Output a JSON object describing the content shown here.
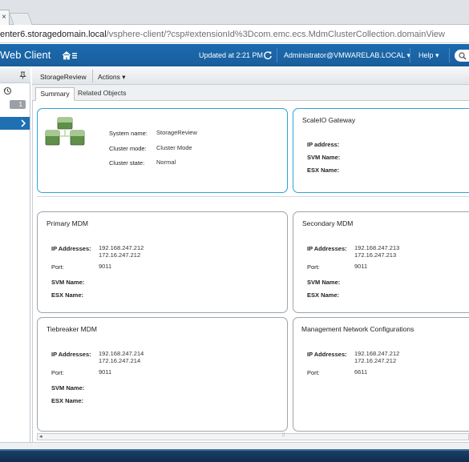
{
  "browser": {
    "tab_close": "×",
    "address_host": "enter6.storagedomain.local",
    "address_path": "/vsphere-client/?csp#extensionId%3Dcom.emc.ecs.MdmClusterCollection.domainView"
  },
  "header": {
    "app_title": "Web Client",
    "updated": "Updated at 2:21 PM",
    "user": "Administrator@VMWARELAB.LOCAL ▾",
    "help": "Help ▾"
  },
  "navigator": {
    "badge": "1"
  },
  "object": {
    "name": "StorageReview",
    "actions": "Actions ▾"
  },
  "tabs": {
    "summary": "Summary",
    "related": "Related Objects"
  },
  "system": {
    "name_label": "System name:",
    "name_value": "StorageReview",
    "mode_label": "Cluster mode:",
    "mode_value": "Cluster Mode",
    "state_label": "Cluster state:",
    "state_value": "Normal"
  },
  "gateway": {
    "title": "ScaleIO Gateway",
    "ip_label": "IP address:",
    "svm_label": "SVM Name:",
    "esx_label": "ESX Name:"
  },
  "primary": {
    "title": "Primary MDM",
    "ip_label": "IP Addresses:",
    "ip1": "192.168.247.212",
    "ip2": "172.16.247.212",
    "port_label": "Port:",
    "port": "9011",
    "svm_label": "SVM Name:",
    "esx_label": "ESX Name:"
  },
  "secondary": {
    "title": "Secondary MDM",
    "ip_label": "IP Addresses:",
    "ip1": "192.168.247.213",
    "ip2": "172.16.247.213",
    "port_label": "Port:",
    "port": "9011",
    "svm_label": "SVM Name:",
    "esx_label": "ESX Name:"
  },
  "tiebreaker": {
    "title": "Tiebreaker MDM",
    "ip_label": "IP Addresses:",
    "ip1": "192.168.247.214",
    "ip2": "172.16.247.214",
    "port_label": "Port:",
    "port": "9011",
    "svm_label": "SVM Name:",
    "esx_label": "ESX Name:"
  },
  "mgmt": {
    "title": "Management Network Configurations",
    "ip_label": "IP Addresses:",
    "ip1": "192.168.247.212",
    "ip2": "172.16.247.212",
    "port_label": "Port:",
    "port": "6611"
  },
  "scroll": {
    "left_arrow": "◂",
    "grip": "⁞⁞"
  },
  "colors": {
    "header_blue": "#1b6bb0",
    "highlight_border": "#2da2d8",
    "selected_nav": "#1f6fb3"
  }
}
